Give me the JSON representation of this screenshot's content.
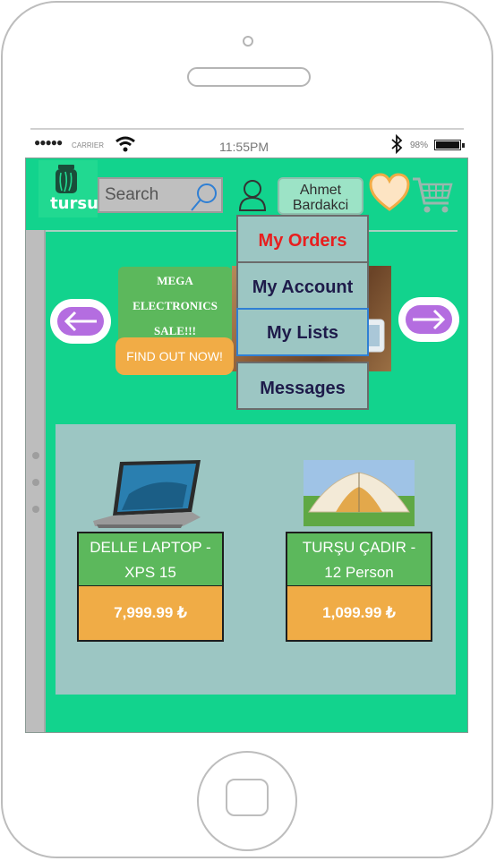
{
  "status_bar": {
    "signal_dots": "●●●●●",
    "carrier": "CARRIER",
    "time": "11:55PM",
    "battery_percent": "98%"
  },
  "header": {
    "logo_text": "tursu",
    "search_placeholder": "Search",
    "user_name_line1": "Ahmet",
    "user_name_line2": "Bardakci"
  },
  "account_menu": {
    "items": [
      {
        "label": "My Orders",
        "state": "active"
      },
      {
        "label": "My Account",
        "state": "normal"
      },
      {
        "label": "My Lists",
        "state": "focused"
      },
      {
        "label": "Messages",
        "state": "normal"
      }
    ]
  },
  "banner": {
    "lines": [
      "MEGA",
      "ELECTRONICS",
      "SALE!!!"
    ],
    "cta": "FIND OUT NOW!"
  },
  "products": [
    {
      "name_line1": "DELLE LAPTOP -",
      "name_line2": "XPS 15",
      "price": "7,999.99 ₺",
      "image": "laptop"
    },
    {
      "name_line1": "TURŞU ÇADIR -",
      "name_line2": "12 Person",
      "price": "1,099.99 ₺",
      "image": "tent"
    }
  ],
  "colors": {
    "app_background": "#12d38d",
    "panel": "#9cc6c3",
    "product_name_bg": "#5cb85c",
    "price_bg": "#f0ac46",
    "arrow_accent": "#b46de0",
    "active_menu_text": "#e81e1e"
  },
  "icons": [
    "jar-logo-icon",
    "search-icon",
    "user-icon",
    "heart-icon",
    "cart-icon",
    "arrow-left-icon",
    "arrow-right-icon",
    "bluetooth-icon",
    "wifi-icon",
    "battery-icon"
  ]
}
